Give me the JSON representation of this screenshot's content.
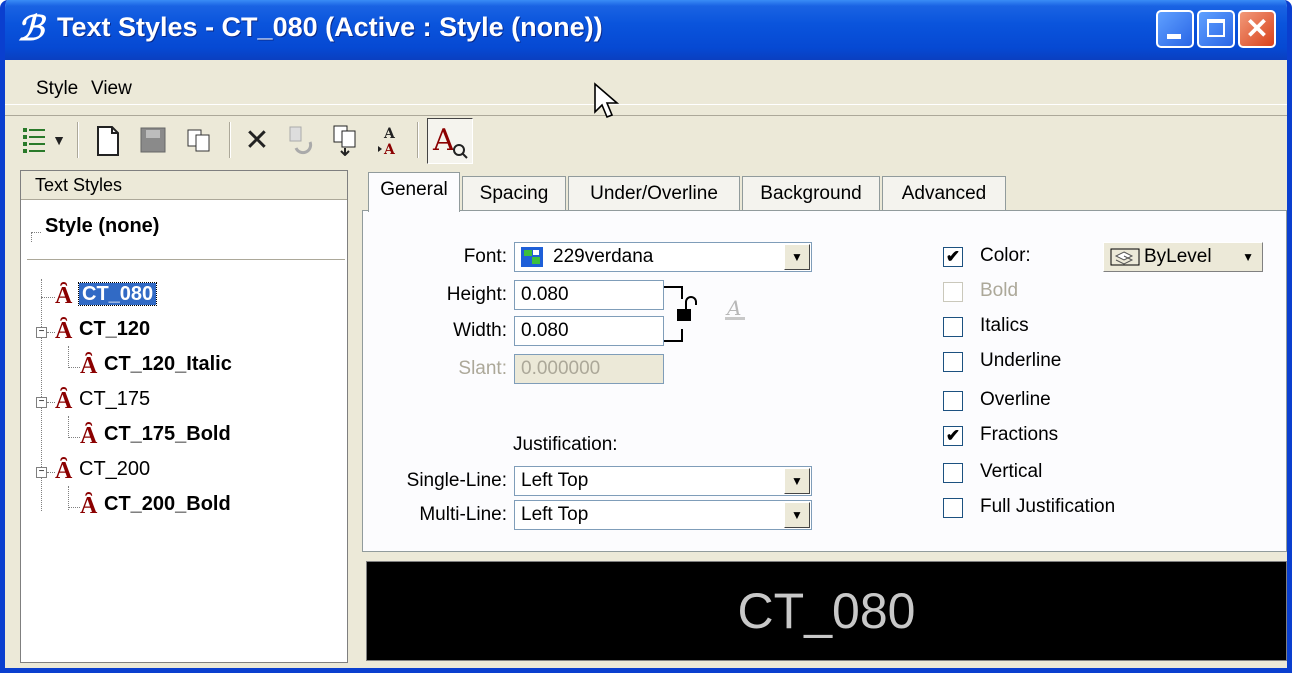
{
  "window": {
    "title": "Text Styles - CT_080 (Active : Style (none))"
  },
  "menu": {
    "style": "Style",
    "view": "View"
  },
  "left_pane": {
    "header": "Text Styles",
    "root": "Style (none)",
    "items": [
      {
        "label": "CT_080"
      },
      {
        "label": "CT_120"
      },
      {
        "label": "CT_120_Italic"
      },
      {
        "label": "CT_175"
      },
      {
        "label": "CT_175_Bold"
      },
      {
        "label": "CT_200"
      },
      {
        "label": "CT_200_Bold"
      }
    ]
  },
  "tabs": [
    "General",
    "Spacing",
    "Under/Overline",
    "Background",
    "Advanced"
  ],
  "general": {
    "font_label": "Font:",
    "font_value": "229verdana",
    "height_label": "Height:",
    "height_value": "0.080",
    "width_label": "Width:",
    "width_value": "0.080",
    "slant_label": "Slant:",
    "slant_value": "0.000000",
    "justification_label": "Justification:",
    "single_line_label": "Single-Line:",
    "single_line_value": "Left Top",
    "multi_line_label": "Multi-Line:",
    "multi_line_value": "Left Top",
    "color_label": "Color:",
    "color_value": "ByLevel",
    "checks": [
      {
        "label": "Bold"
      },
      {
        "label": "Italics"
      },
      {
        "label": "Underline"
      },
      {
        "label": "Overline"
      },
      {
        "label": "Fractions"
      },
      {
        "label": "Vertical"
      },
      {
        "label": "Full Justification"
      }
    ]
  },
  "preview": {
    "text": "CT_080"
  }
}
